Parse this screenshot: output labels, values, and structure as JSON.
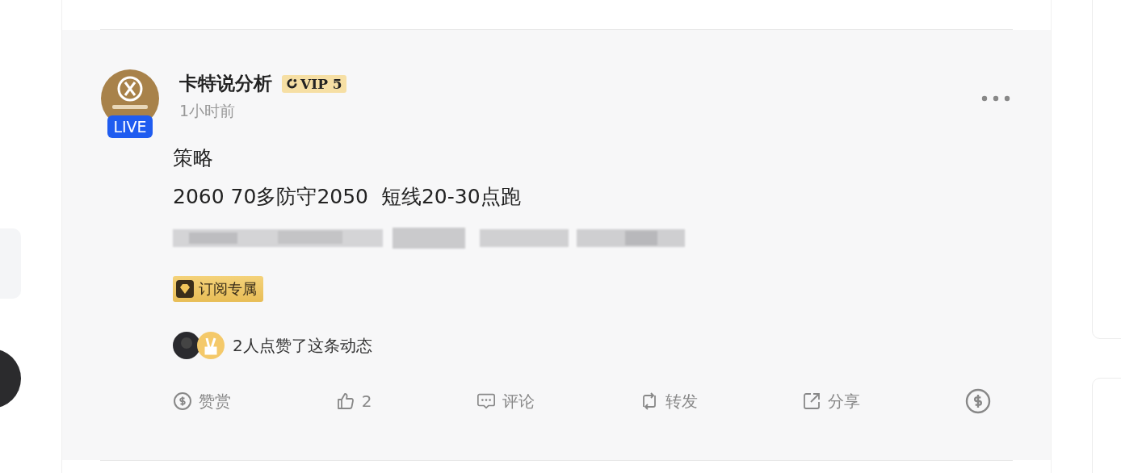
{
  "post": {
    "author": "卡特说分析",
    "vip_badge": "VIP 5",
    "live_badge": "LIVE",
    "time": "1小时前",
    "lines": [
      "策略",
      "2060 70多防守2050  短线20-30点跑"
    ],
    "subscriber_tag": "订阅专属",
    "likes_text": "2人点赞了这条动态",
    "actions": [
      {
        "kind": "reward",
        "label": "赞赏"
      },
      {
        "kind": "like",
        "label": "2"
      },
      {
        "kind": "comment",
        "label": "评论"
      },
      {
        "kind": "repost",
        "label": "转发"
      },
      {
        "kind": "share",
        "label": "分享"
      },
      {
        "kind": "tip"
      }
    ]
  }
}
